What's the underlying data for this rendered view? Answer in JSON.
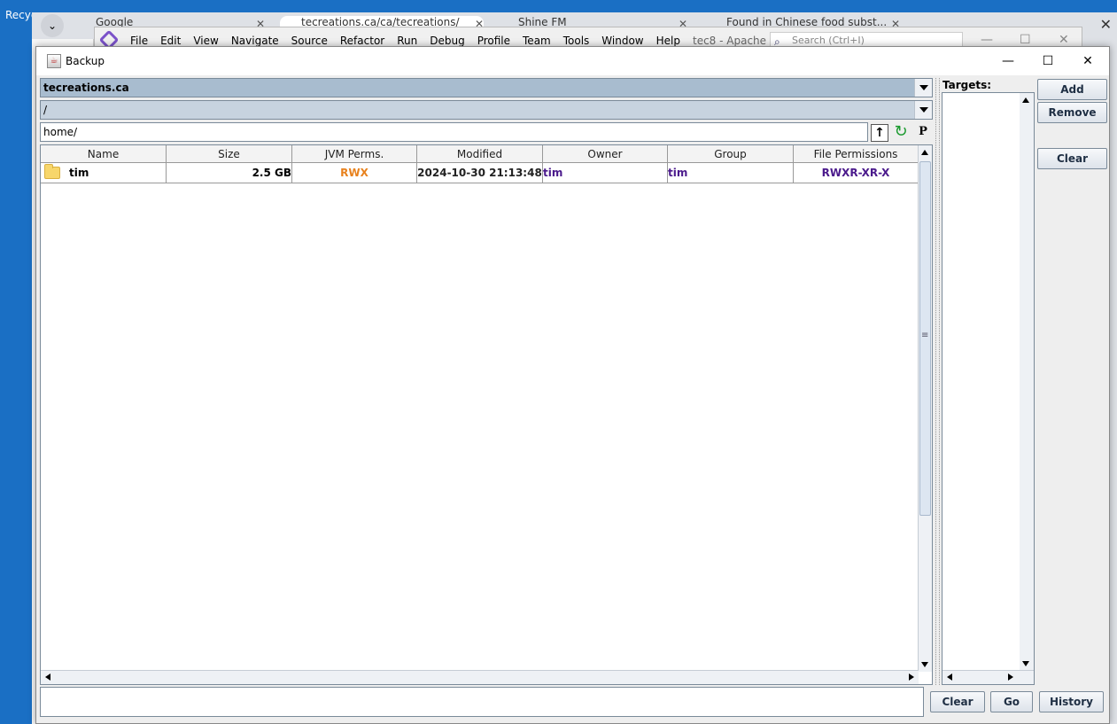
{
  "desktop": {
    "label": "Recyc"
  },
  "browser": {
    "tabs": [
      {
        "title": "Google"
      },
      {
        "title": "tecreations.ca/ca/tecreations/"
      },
      {
        "title": "Shine FM"
      },
      {
        "title": "Found in Chinese food subst..."
      }
    ]
  },
  "ide": {
    "menu": [
      "File",
      "Edit",
      "View",
      "Navigate",
      "Source",
      "Refactor",
      "Run",
      "Debug",
      "Profile",
      "Team",
      "Tools",
      "Window",
      "Help"
    ],
    "title": "tec8 - Apache ...",
    "search_placeholder": "Search (Ctrl+I)"
  },
  "dialog": {
    "title": "Backup",
    "host": "tecreations.ca",
    "root_path": "/",
    "current_path": "home/",
    "columns": [
      "Name",
      "Size",
      "JVM Perms.",
      "Modified",
      "Owner",
      "Group",
      "File Permissions"
    ],
    "rows": [
      {
        "name": "tim",
        "size": "2.5 GB",
        "jvm_perms": "RWX",
        "modified": "2024-10-30 21:13:48",
        "owner": "tim",
        "group": "tim",
        "file_permissions": "RWXR-XR-X"
      }
    ],
    "targets_label": "Targets:",
    "buttons": {
      "add": "Add",
      "remove": "Remove",
      "clear_targets": "Clear",
      "clear": "Clear",
      "go": "Go",
      "history": "History"
    },
    "command_value": ""
  },
  "colors": {
    "jvm_perms": "#e8821e",
    "owner_group": "#4b1a8c",
    "host_combo": "#a8bccf",
    "refresh": "#1a9a2e"
  }
}
